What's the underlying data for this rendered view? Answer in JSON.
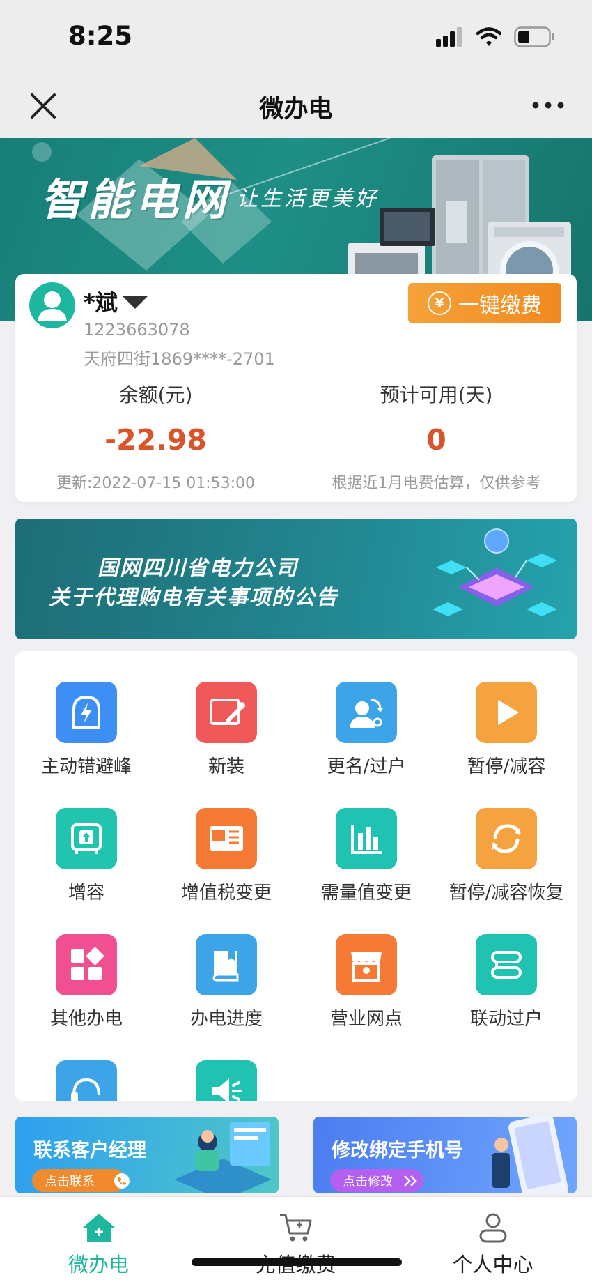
{
  "status_bar": {
    "time": "8:25"
  },
  "nav": {
    "title": "微办电"
  },
  "hero": {
    "slogan": "智能电网",
    "slogan_sub": "让生活更美好"
  },
  "account": {
    "name": "*斌",
    "account_no": "1223663078",
    "address": "天府四街1869****-2701",
    "pay_button": "一键缴费",
    "pay_icon_glyph": "¥",
    "balance_label": "余额(元)",
    "balance_value": "-22.98",
    "updated": "更新:2022-07-15 01:53:00",
    "days_label": "预计可用(天)",
    "days_value": "0",
    "days_note": "根据近1月电费估算，仅供参考"
  },
  "notice": {
    "line1": "国网四川省电力公司",
    "line2": "关于代理购电有关事项的公告"
  },
  "services": [
    {
      "label": "主动错避峰",
      "icon": "lightning-dome-icon",
      "color": "#3d8ff5"
    },
    {
      "label": "新装",
      "icon": "wrench-card-icon",
      "color": "#f0585a"
    },
    {
      "label": "更名/过户",
      "icon": "user-transfer-icon",
      "color": "#3ea4e8"
    },
    {
      "label": "暂停/减容",
      "icon": "play-icon",
      "color": "#f4a340"
    },
    {
      "label": "增容",
      "icon": "capacity-up-icon",
      "color": "#21c4ae"
    },
    {
      "label": "增值税变更",
      "icon": "tax-icon",
      "color": "#f47a35"
    },
    {
      "label": "需量值变更",
      "icon": "bar-chart-icon",
      "color": "#20c2b2"
    },
    {
      "label": "暂停/减容恢复",
      "icon": "refresh-icon",
      "color": "#f4a340"
    },
    {
      "label": "其他办电",
      "icon": "grid-icon",
      "color": "#f0508f"
    },
    {
      "label": "办电进度",
      "icon": "book-icon",
      "color": "#3ea4e8"
    },
    {
      "label": "营业网点",
      "icon": "store-icon",
      "color": "#f47a35"
    },
    {
      "label": "联动过户",
      "icon": "link-icon",
      "color": "#20c2b2"
    },
    {
      "label": "",
      "icon": "headset-icon",
      "color": "#3ea4e8"
    },
    {
      "label": "",
      "icon": "speaker-icon",
      "color": "#20c2b2"
    }
  ],
  "promos": {
    "manager": {
      "title": "联系客户经理",
      "button": "点击联系"
    },
    "phone": {
      "title": "修改绑定手机号",
      "button": "点击修改"
    }
  },
  "tabs": [
    {
      "label": "微办电",
      "icon": "home-icon",
      "active": true
    },
    {
      "label": "充值缴费",
      "icon": "cart-icon",
      "active": false
    },
    {
      "label": "个人中心",
      "icon": "user-icon",
      "active": false
    }
  ],
  "colors": {
    "brand_green": "#1cb79e",
    "pay_orange": "#f08a1e",
    "amount_red": "#d8542a"
  }
}
